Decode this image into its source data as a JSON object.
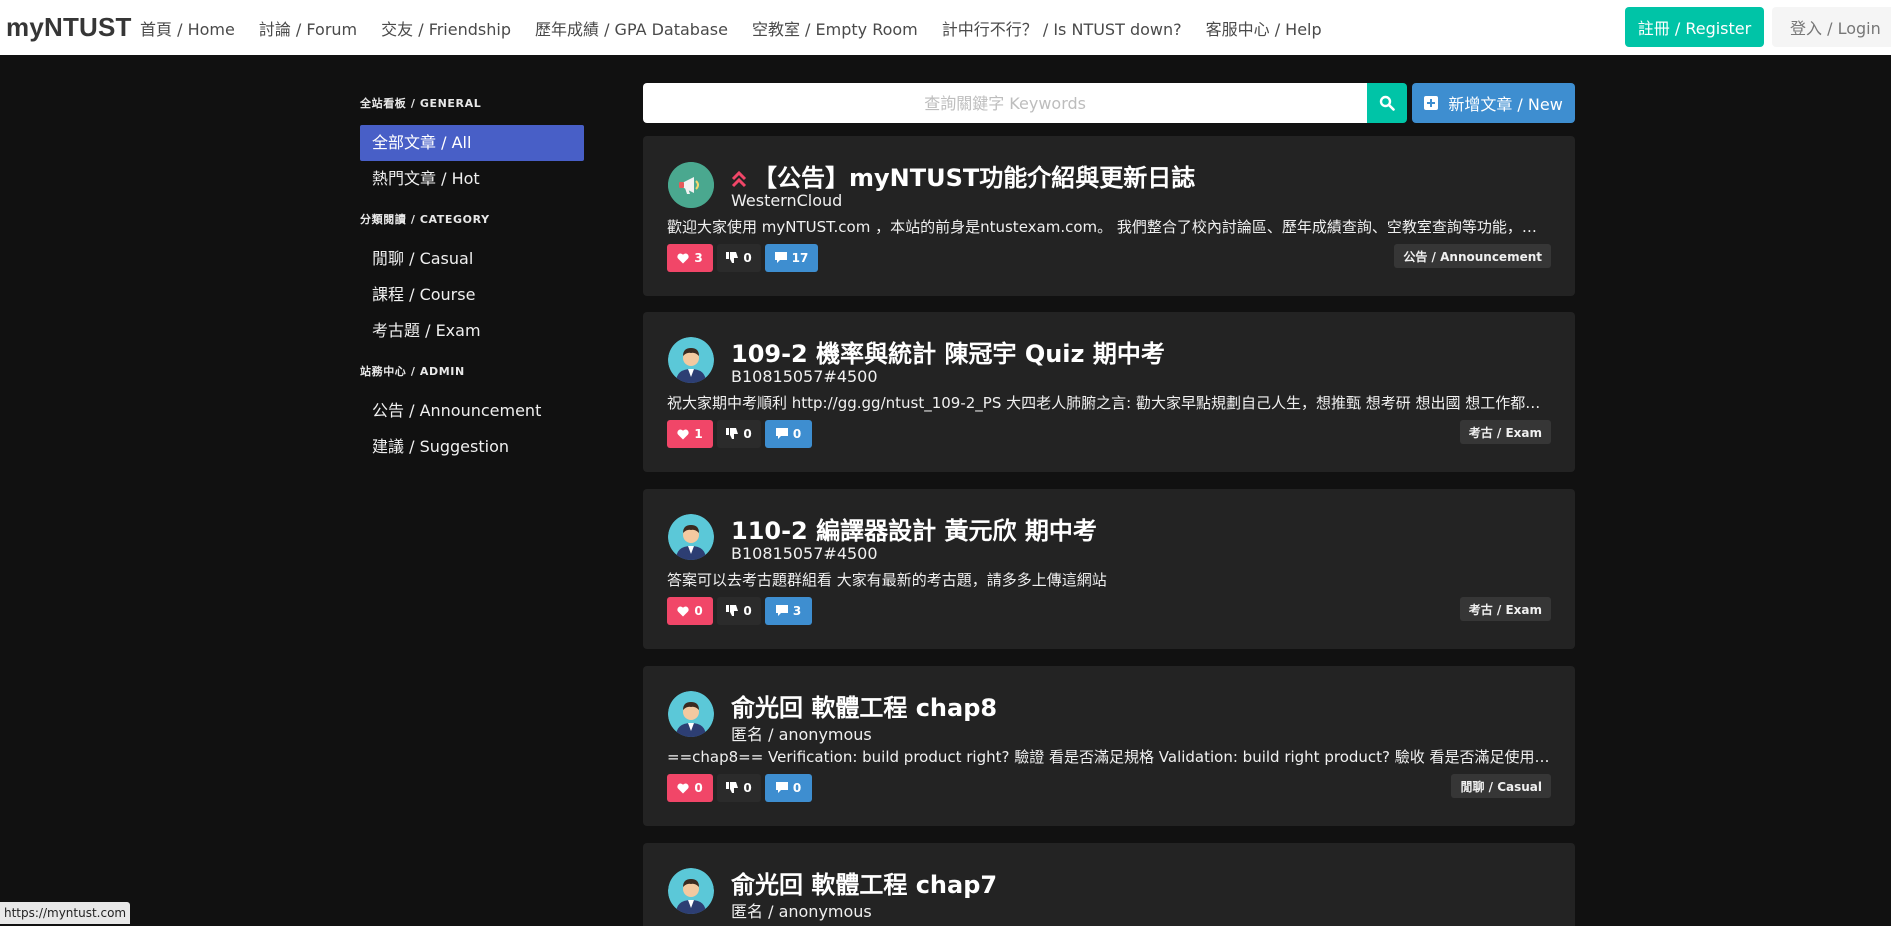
{
  "navbar": {
    "brand": "myNTUST",
    "links": [
      "首頁 / Home",
      "討論 / Forum",
      "交友 / Friendship",
      "歷年成績 / GPA Database",
      "空教室 / Empty Room",
      "計中行不行？ / Is NTUST down?",
      "客服中心 / Help"
    ],
    "register": "註冊 / Register",
    "login": "登入 / Login"
  },
  "sidebar": {
    "sections": [
      {
        "label": "全站看板 / GENERAL",
        "items": [
          "全部文章 / All",
          "熱門文章 / Hot"
        ]
      },
      {
        "label": "分類閱讀 / CATEGORY",
        "items": [
          "閒聊 / Casual",
          "課程 / Course",
          "考古題 / Exam"
        ]
      },
      {
        "label": "站務中心 / ADMIN",
        "items": [
          "公告 / Announcement",
          "建議 / Suggestion"
        ]
      }
    ],
    "active_item": "全部文章 / All"
  },
  "search": {
    "placeholder": "查詢關鍵字 Keywords",
    "new_button": "新增文章 / New"
  },
  "posts": [
    {
      "title": "【公告】myNTUST功能介紹與更新日誌",
      "pinned": true,
      "author": "WesternCloud",
      "excerpt": "歡迎大家使用 myNTUST.com ，本站的前身是ntustexam.com。 我們整合了校內討論區、歷年成績查詢、空教室查詢等功能，讓同學們能在同一個網站中找到所需要的資訊。",
      "likes": "3",
      "dislikes": "0",
      "comments": "17",
      "tag": "公告 / Announcement",
      "avatar": "megaphone"
    },
    {
      "title": "109-2 機率與統計 陳冠宇 Quiz 期中考",
      "pinned": false,
      "author": "B10815057#4500",
      "excerpt": "祝大家期中考順利 http://gg.gg/ntust_109-2_PS 大四老人肺腑之言: 勸大家早點規劃自己人生，想推甄 想考研 想出國 想工作都要提早準備",
      "likes": "1",
      "dislikes": "0",
      "comments": "0",
      "tag": "考古 / Exam",
      "avatar": "person"
    },
    {
      "title": "110-2 編譯器設計 黃元欣 期中考",
      "pinned": false,
      "author": "B10815057#4500",
      "excerpt": "答案可以去考古題群組看 大家有最新的考古題，請多多上傳這網站",
      "likes": "0",
      "dislikes": "0",
      "comments": "3",
      "tag": "考古 / Exam",
      "avatar": "person"
    },
    {
      "title": "俞光回 軟體工程 chap8",
      "pinned": false,
      "author": "匿名 / anonymous",
      "excerpt": "==chap8== Verification: build product right? 驗證 看是否滿足規格 Validation: build right product? 驗收 看是否滿足使用者需求",
      "likes": "0",
      "dislikes": "0",
      "comments": "0",
      "tag": "閒聊 / Casual",
      "avatar": "person"
    },
    {
      "title": "俞光回 軟體工程 chap7",
      "pinned": false,
      "author": "匿名 / anonymous",
      "excerpt": "",
      "likes": "",
      "dislikes": "",
      "comments": "",
      "tag": "",
      "avatar": "person"
    }
  ],
  "status_bar": {
    "url": "https://myntust.com"
  }
}
